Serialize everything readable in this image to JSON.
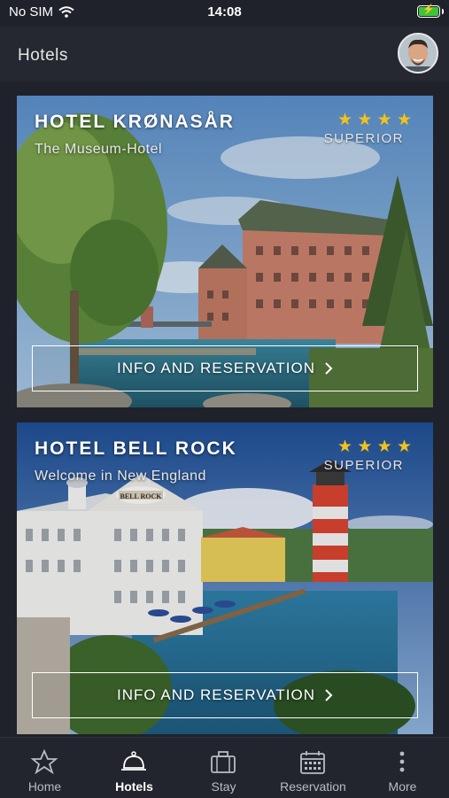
{
  "status_bar": {
    "carrier": "No SIM",
    "time": "14:08"
  },
  "header": {
    "title": "Hotels"
  },
  "hotels": [
    {
      "name": "HOTEL KRØNASÅR",
      "tagline": "The Museum-Hotel",
      "stars": "★ ★ ★ ★",
      "category": "SUPERIOR",
      "cta": "INFO AND RESERVATION"
    },
    {
      "name": "HOTEL BELL ROCK",
      "tagline": "Welcome in New England",
      "stars": "★ ★ ★ ★",
      "category": "SUPERIOR",
      "cta": "INFO AND RESERVATION",
      "sign": "BELL ROCK"
    }
  ],
  "tabs": [
    {
      "label": "Home",
      "icon": "star-icon"
    },
    {
      "label": "Hotels",
      "icon": "bell-icon",
      "active": true
    },
    {
      "label": "Stay",
      "icon": "suitcase-icon"
    },
    {
      "label": "Reservation",
      "icon": "calendar-icon"
    },
    {
      "label": "More",
      "icon": "more-icon"
    }
  ],
  "colors": {
    "accent_star": "#f2c21b",
    "background": "#1f222a",
    "battery": "#3ec43a"
  }
}
